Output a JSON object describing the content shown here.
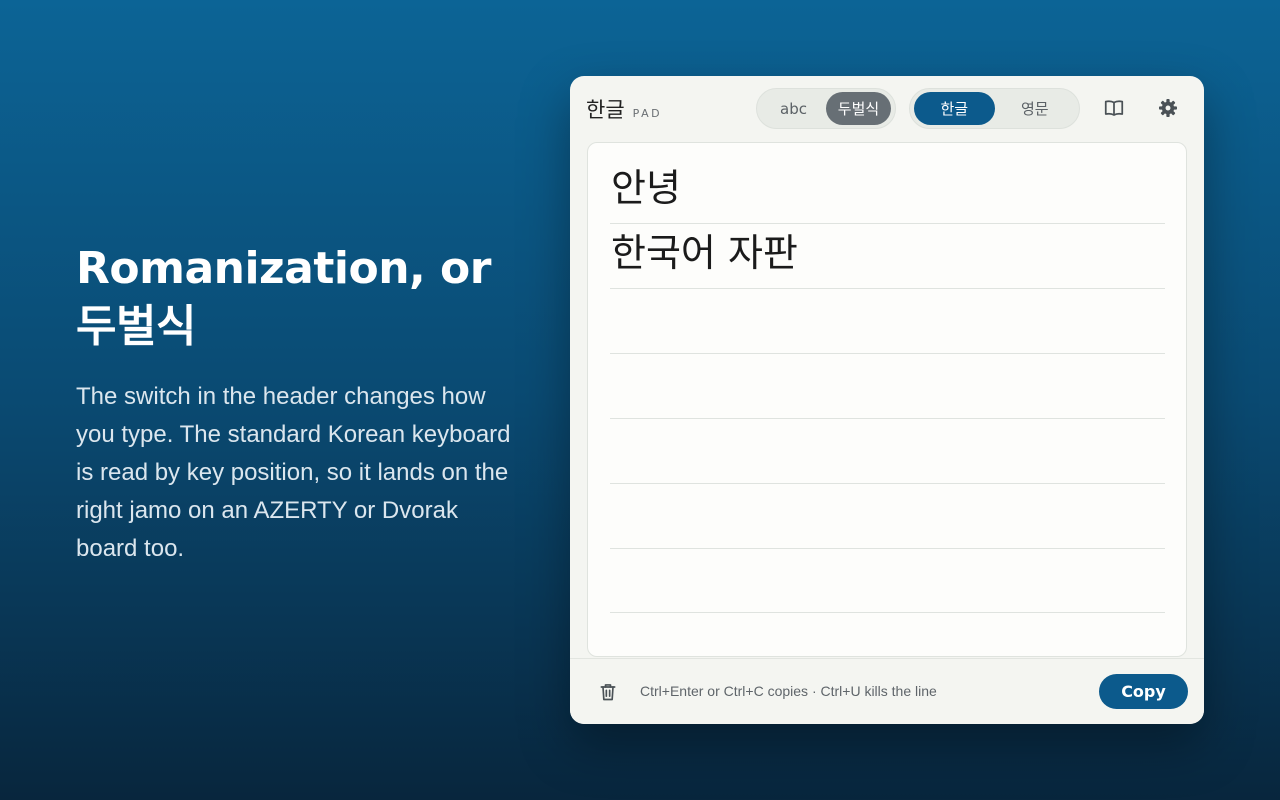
{
  "promo": {
    "title_line1": "Romanization, or",
    "title_line2": "두벌식",
    "body": "The switch in the header changes how you type. The standard Korean keyboard is read by key position, so it lands on the right jamo on an AZERTY or Dvorak board too."
  },
  "header": {
    "brand": "한글",
    "brand_sub": "PAD",
    "mode_options": [
      {
        "label": "abc",
        "selected": false
      },
      {
        "label": "두벌식",
        "selected": true
      }
    ],
    "lang_options": [
      {
        "label": "한글",
        "selected": true
      },
      {
        "label": "영문",
        "selected": false
      }
    ],
    "icons": [
      "book-icon",
      "gear-icon"
    ]
  },
  "editor": {
    "lines": [
      "안녕",
      "한국어 자판",
      "",
      "",
      "",
      "",
      ""
    ]
  },
  "footer": {
    "hint": "Ctrl+Enter or Ctrl+C copies · Ctrl+U kills the line",
    "copy_label": "Copy"
  },
  "colors": {
    "accent": "#0c5a8c",
    "active_gray": "#676f75",
    "panel_bg": "#f4f5f1"
  }
}
